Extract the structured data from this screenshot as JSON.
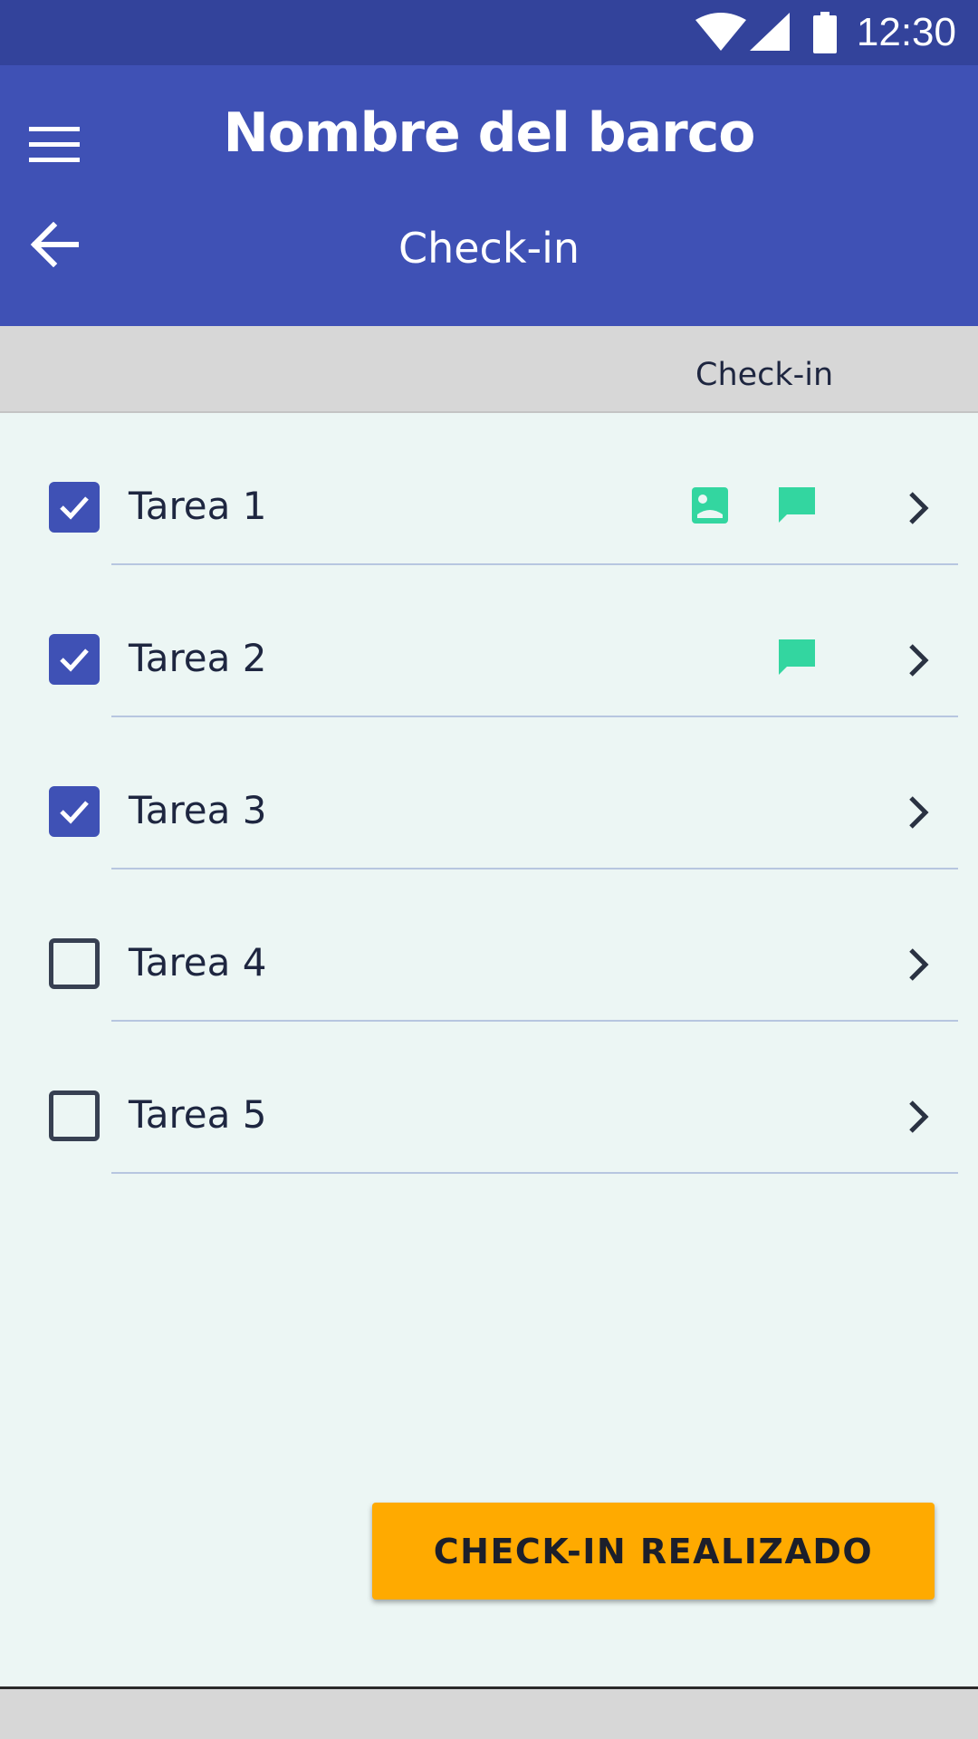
{
  "status_bar": {
    "time": "12:30",
    "icons": [
      "wifi-icon",
      "signal-icon",
      "battery-icon"
    ],
    "background": "#33439b"
  },
  "app_bar": {
    "title": "Nombre del barco",
    "subtitle": "Check-in",
    "menu_icon": "menu-icon",
    "back_icon": "arrow-back-icon",
    "background": "#3f51b5"
  },
  "section_header": {
    "label": "Check-in"
  },
  "tasks": [
    {
      "label": "Tarea 1",
      "checked": true,
      "has_image": true,
      "has_comment": true
    },
    {
      "label": "Tarea 2",
      "checked": true,
      "has_image": false,
      "has_comment": true
    },
    {
      "label": "Tarea 3",
      "checked": true,
      "has_image": false,
      "has_comment": false
    },
    {
      "label": "Tarea 4",
      "checked": false,
      "has_image": false,
      "has_comment": false
    },
    {
      "label": "Tarea 5",
      "checked": false,
      "has_image": false,
      "has_comment": false
    }
  ],
  "action_button": {
    "label": "CHECK-IN REALIZADO",
    "color": "#ffaa00"
  },
  "colors": {
    "primary": "#3f51b5",
    "accent_green": "#33d6a0",
    "content_background": "#ecf6f4",
    "divider": "#b7c6e0"
  }
}
